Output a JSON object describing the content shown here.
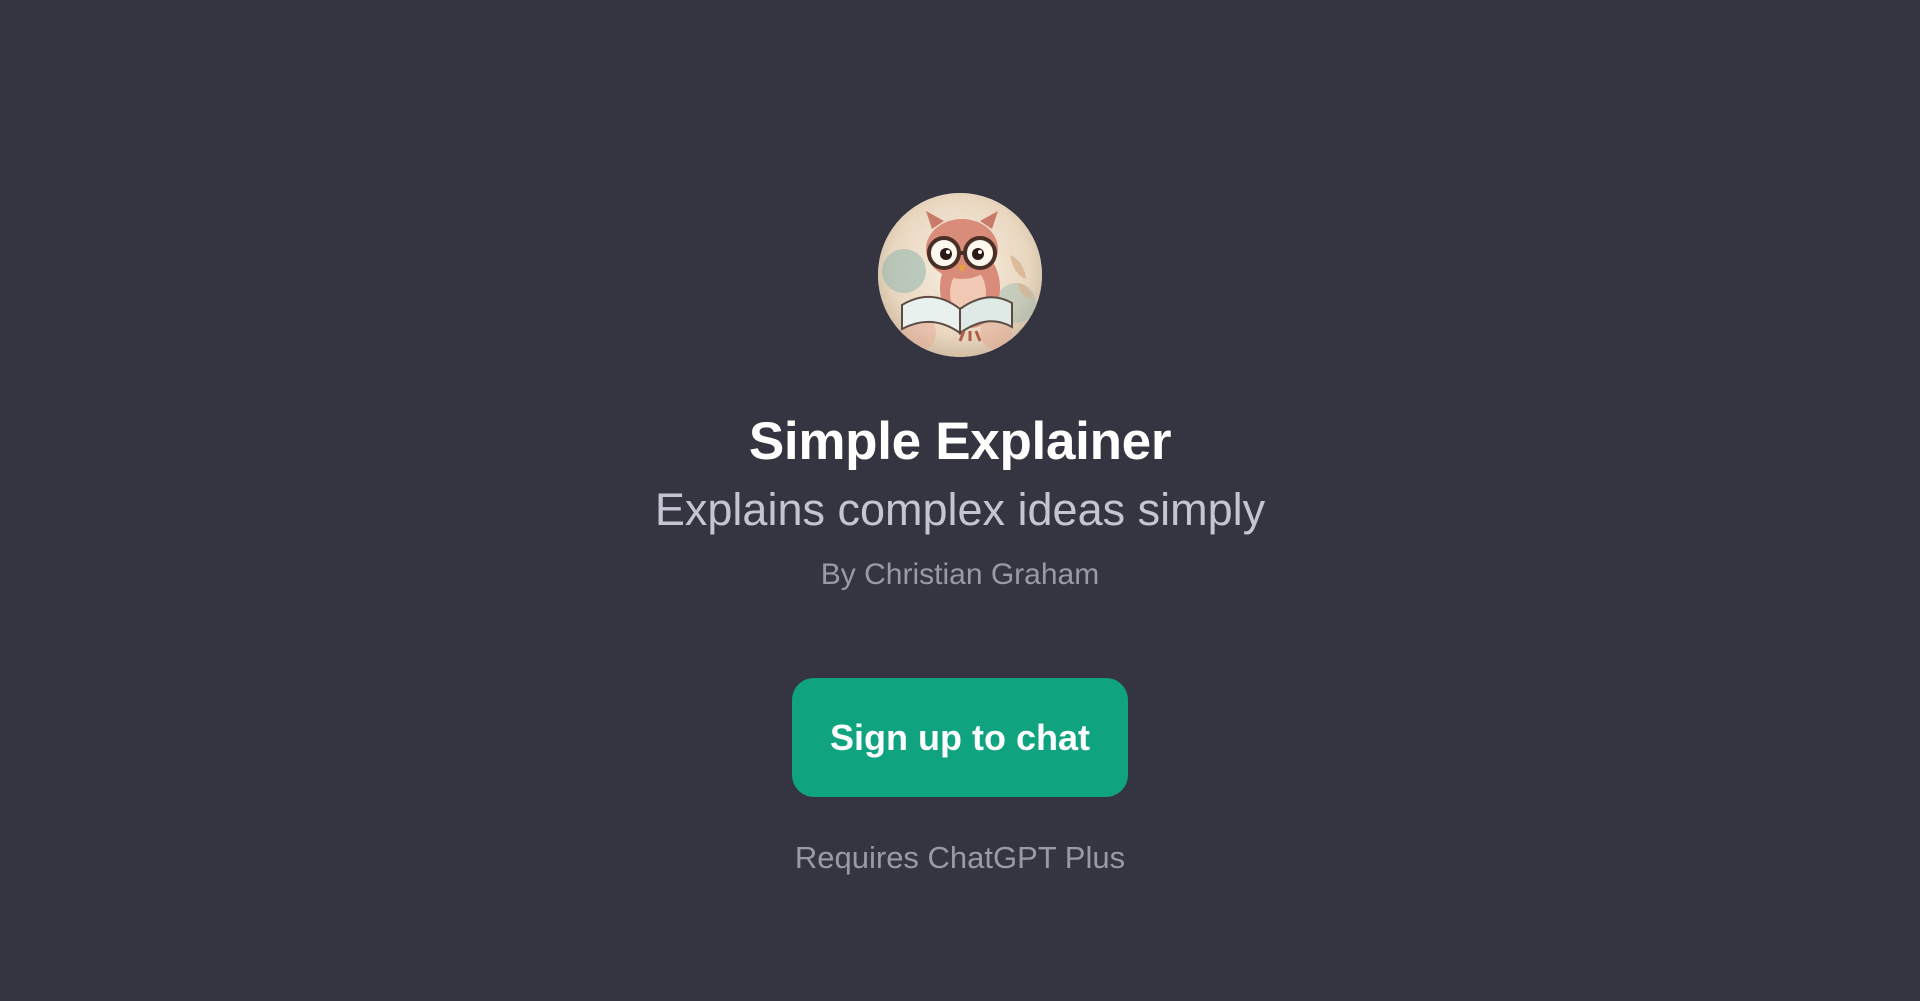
{
  "gpt": {
    "avatar_icon": "owl-reading-book-icon",
    "title": "Simple Explainer",
    "description": "Explains complex ideas simply",
    "author": "By Christian Graham"
  },
  "actions": {
    "signup_label": "Sign up to chat"
  },
  "footer": {
    "requires_label": "Requires ChatGPT Plus"
  },
  "colors": {
    "background": "#343541",
    "title": "#ffffff",
    "subtitle": "#c5c5d2",
    "muted": "#9a9aa6",
    "accent": "#10a37f"
  }
}
